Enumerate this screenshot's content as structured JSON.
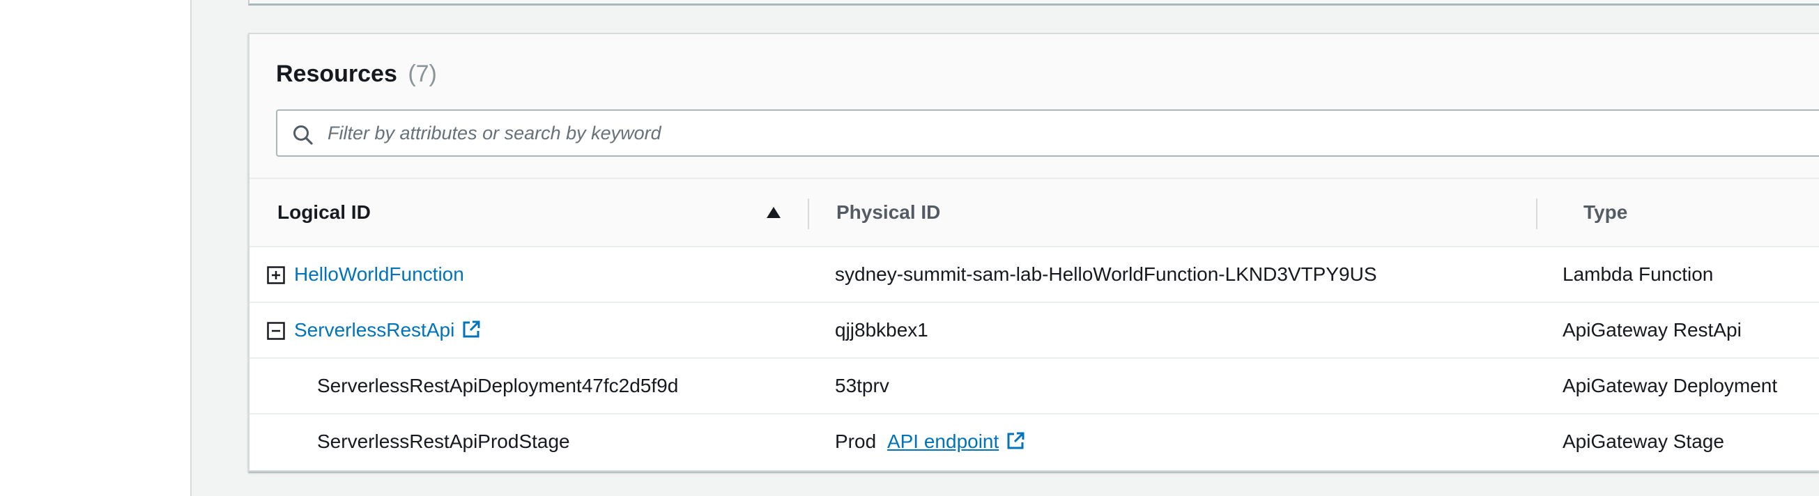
{
  "resources": {
    "title": "Resources",
    "count": "(7)",
    "filter_placeholder": "Filter by attributes or search by keyword",
    "filter_value": "",
    "columns": {
      "logical_id": "Logical ID",
      "physical_id": "Physical ID",
      "type": "Type"
    },
    "sort": {
      "column": "Logical ID",
      "direction": "ascending"
    },
    "rows": [
      {
        "logical_id": "HelloWorldFunction",
        "physical_id": "sydney-summit-sam-lab-HelloWorldFunction-LKND3VTPY9US",
        "type": "Lambda Function",
        "toggle": "expand"
      },
      {
        "logical_id": "ServerlessRestApi",
        "physical_id": "qjj8bkbex1",
        "type": "ApiGateway RestApi",
        "toggle": "collapse"
      },
      {
        "logical_id": "ServerlessRestApiDeployment47fc2d5f9d",
        "physical_id": "53tprv",
        "type": "ApiGateway Deployment"
      },
      {
        "logical_id": "ServerlessRestApiProdStage",
        "physical_id": "Prod",
        "physical_link": "API endpoint",
        "type": "ApiGateway Stage"
      }
    ]
  },
  "colors": {
    "link": "#0073bb",
    "text": "#16191f",
    "header_text": "#545b64",
    "background": "#f2f3f3",
    "count": "#879596"
  }
}
